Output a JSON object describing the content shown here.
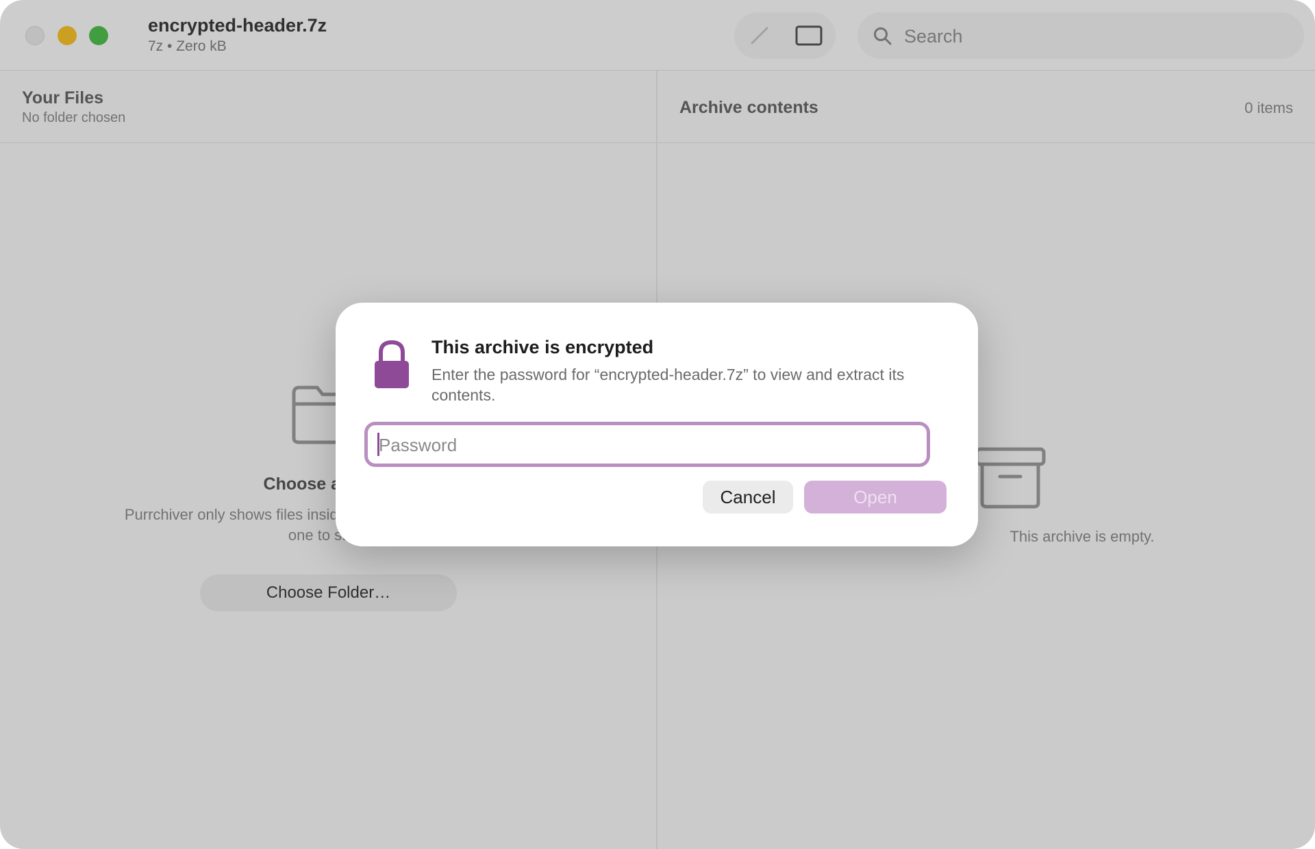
{
  "window": {
    "title": "encrypted-header.7z",
    "subtitle": "7z • Zero kB"
  },
  "toolbar": {
    "edit_icon": "pencil-icon",
    "sidebar_icon": "sidebar-toggle-icon"
  },
  "search": {
    "placeholder": "Search",
    "icon": "search-icon"
  },
  "left_pane": {
    "title": "Your Files",
    "subtitle": "No folder chosen",
    "empty_icon": "folder-icon",
    "empty_title": "Choose a folder",
    "empty_body": "Purrchiver only shows files inside the folder you choose. Pick one to start.",
    "choose_button": "Choose Folder…"
  },
  "right_pane": {
    "title": "Archive contents",
    "count": "0 items",
    "empty_icon": "archive-box-icon",
    "empty_text": "This archive is empty."
  },
  "dialog": {
    "icon": "lock-icon",
    "title": "This archive is encrypted",
    "message": "Enter the password for “encrypted-header.7z” to view and extract its contents.",
    "password_placeholder": "Password",
    "password_value": "",
    "cancel_label": "Cancel",
    "open_label": "Open"
  },
  "colors": {
    "accent": "#8E4A96",
    "open_button_disabled": "#D4B1D8",
    "close_button": "#E6E6E6",
    "minimize_button": "#F5C12A",
    "maximize_button": "#4FBD4E"
  }
}
